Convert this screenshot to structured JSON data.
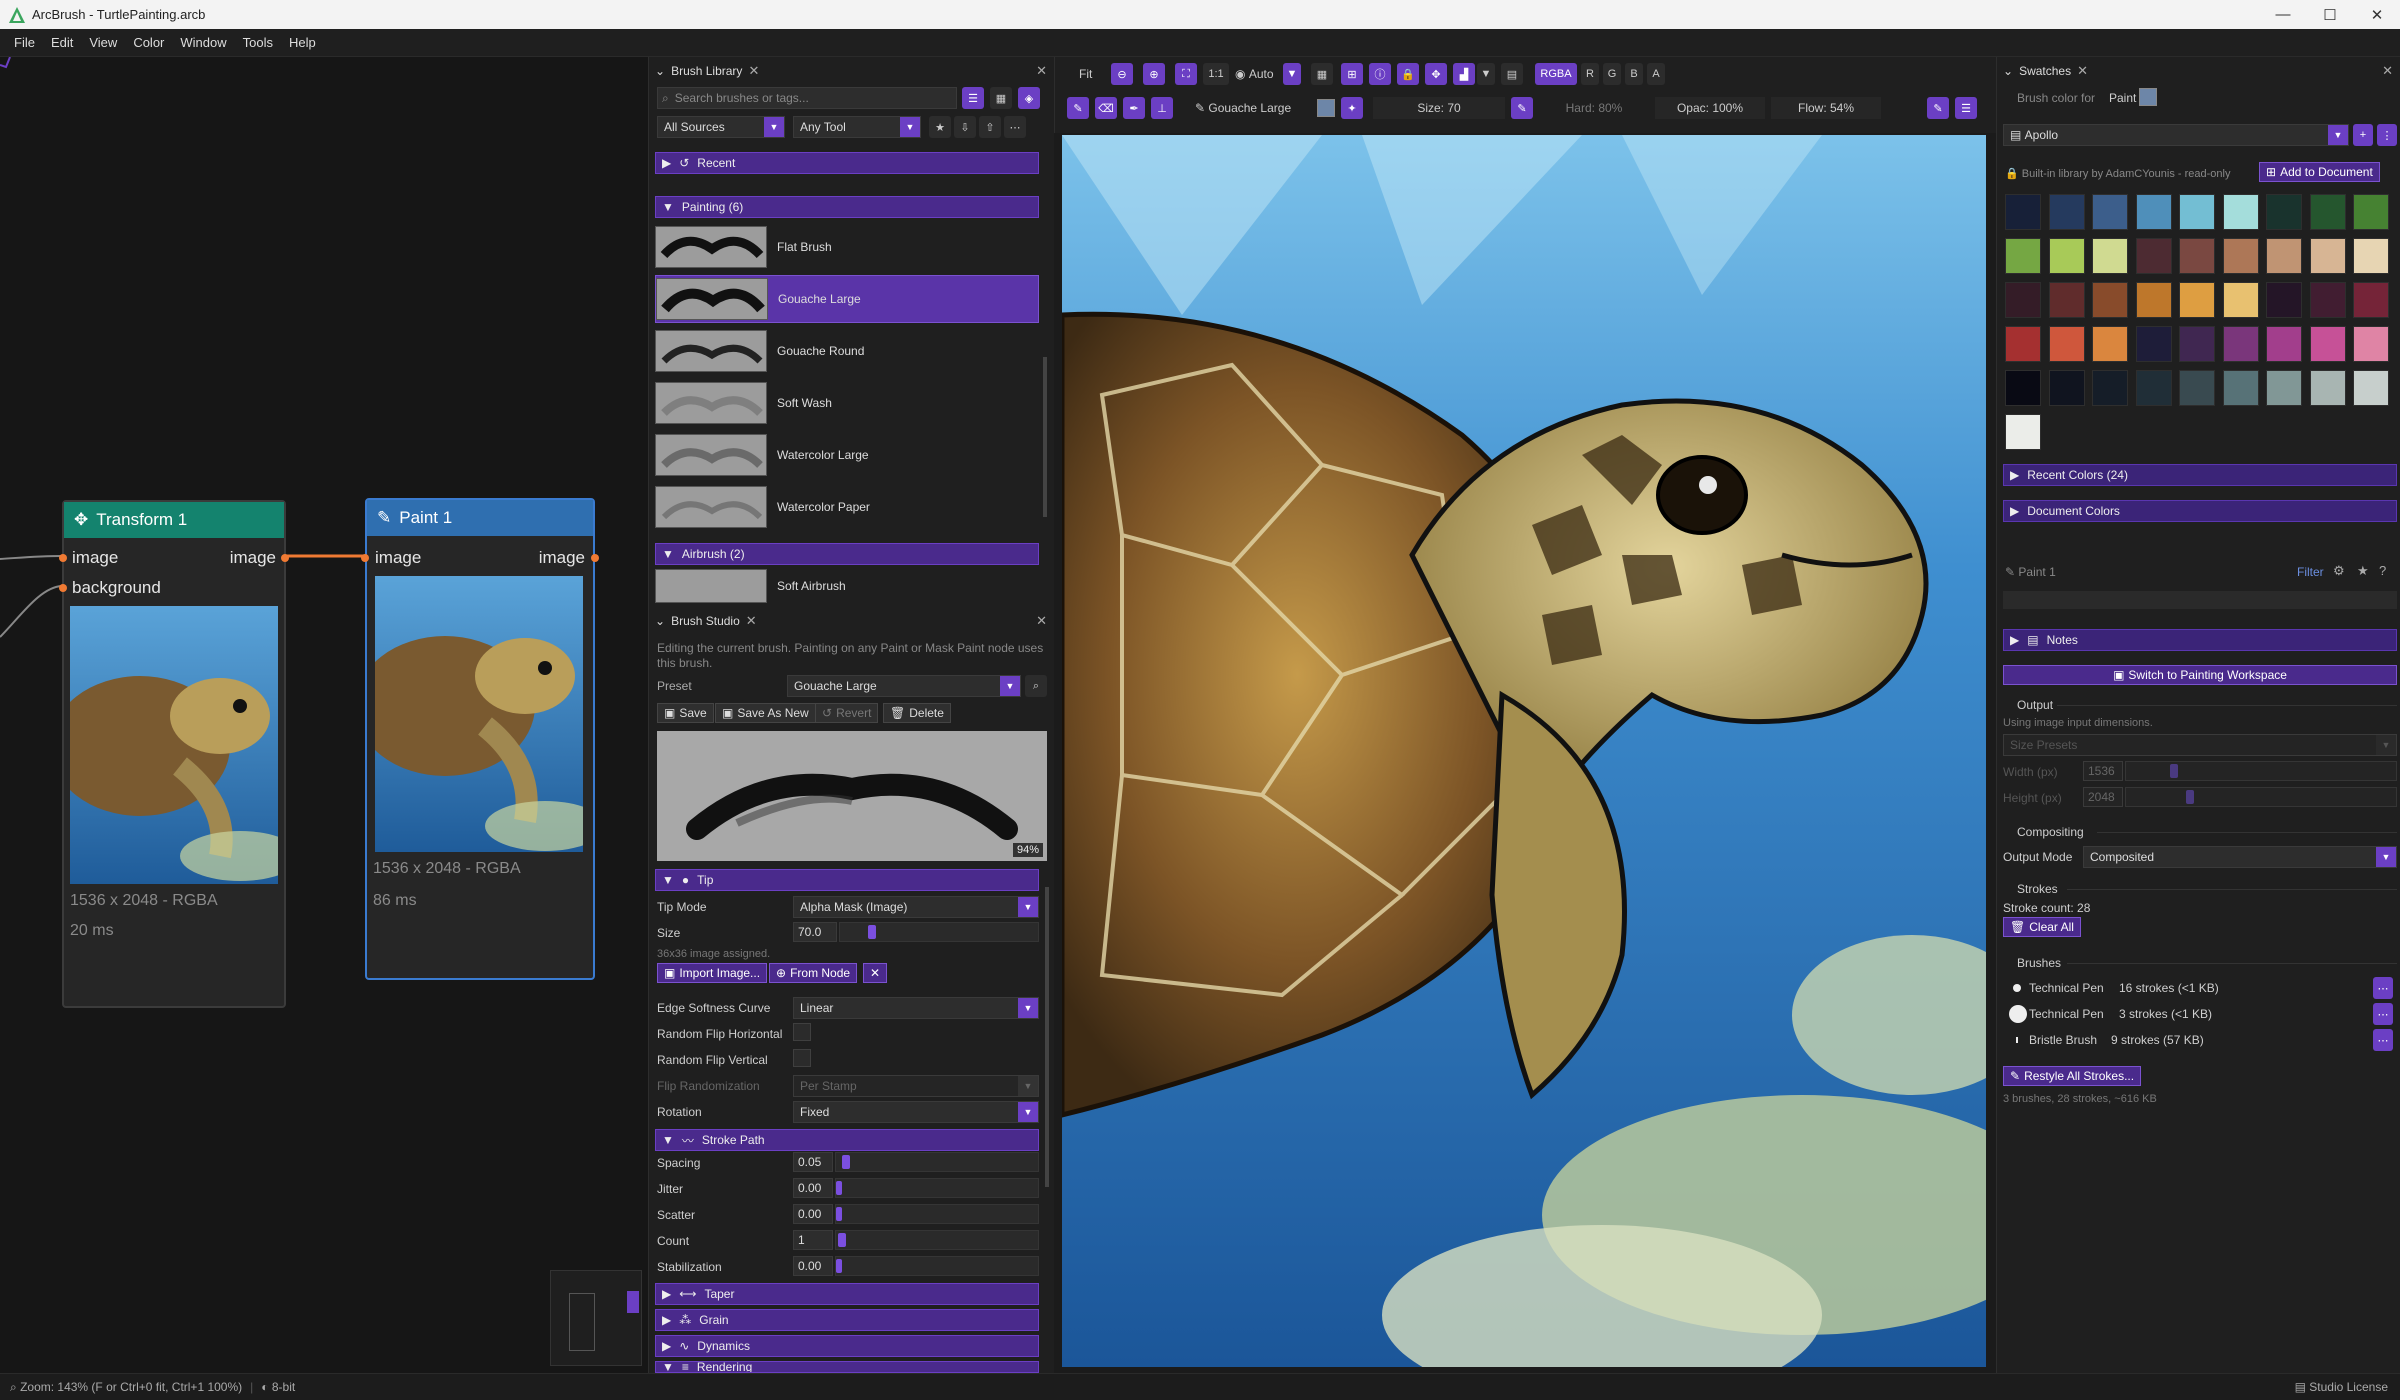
{
  "window": {
    "title": "ArcBrush - TurtlePainting.arcb",
    "minimize": "—",
    "maximize": "☐",
    "close": "✕"
  },
  "menu": [
    "File",
    "Edit",
    "View",
    "Color",
    "Window",
    "Tools",
    "Help"
  ],
  "nodes": {
    "transform": {
      "title": "Transform 1",
      "in_image": "image",
      "in_background": "background",
      "out_image": "image",
      "dims": "1536 x 2048  -  RGBA",
      "time": "20 ms",
      "header_color": "#14836e"
    },
    "paint": {
      "title": "Paint 1",
      "in_image": "image",
      "out_image": "image",
      "dims": "1536 x 2048  -  RGBA",
      "time": "86 ms",
      "header_color": "#2f6fb0"
    }
  },
  "brush_library": {
    "title": "Brush Library",
    "search_placeholder": "Search brushes or tags...",
    "source_filter": "All Sources",
    "tool_filter": "Any Tool",
    "recent": "Recent",
    "painting_group": "Painting (6)",
    "brushes": [
      "Flat Brush",
      "Gouache Large",
      "Gouache Round",
      "Soft Wash",
      "Watercolor Large",
      "Watercolor Paper"
    ],
    "selected": "Gouache Large",
    "airbrush_group": "Airbrush (2)",
    "airbrushes": [
      "Soft Airbrush"
    ]
  },
  "brush_studio": {
    "title": "Brush Studio",
    "desc": "Editing the current brush. Painting on any Paint or Mask Paint node uses this brush.",
    "preset_label": "Preset",
    "preset": "Gouache Large",
    "save": "Save",
    "save_as_new": "Save As New",
    "revert": "Revert",
    "delete": "Delete",
    "preview_zoom": "94%",
    "tip_section": "Tip",
    "tip_mode_label": "Tip Mode",
    "tip_mode": "Alpha Mask (Image)",
    "size_label": "Size",
    "size": "70.0",
    "size_level": 0.14,
    "image_note": "36x36 image assigned.",
    "import_image": "Import Image...",
    "from_node": "From Node",
    "clear": "✕",
    "edge_label": "Edge Softness Curve",
    "edge": "Linear",
    "flip_h": "Random Flip Horizontal",
    "flip_v": "Random Flip Vertical",
    "flip_rand_label": "Flip Randomization",
    "flip_rand": "Per Stamp",
    "rotation_label": "Rotation",
    "rotation": "Fixed",
    "stroke_path": "Stroke Path",
    "params": [
      {
        "label": "Spacing",
        "value": "0.05",
        "level": 0.03
      },
      {
        "label": "Jitter",
        "value": "0.00",
        "level": 0.0
      },
      {
        "label": "Scatter",
        "value": "0.00",
        "level": 0.0
      },
      {
        "label": "Count",
        "value": "1",
        "level": 0.01
      },
      {
        "label": "Stabilization",
        "value": "0.00",
        "level": 0.0
      }
    ],
    "collapsed": [
      "Taper",
      "Grain",
      "Dynamics",
      "Rendering"
    ]
  },
  "toolbar": {
    "fit": "Fit",
    "zoom_auto": "Auto",
    "one_to_one": "1:1",
    "channels": [
      "RGBA",
      "R",
      "G",
      "B",
      "A"
    ],
    "brush_name": "Gouache Large",
    "size": "Size: 70",
    "hard": "Hard: 80%",
    "opac": "Opac: 100%",
    "flow": "Flow: 54%"
  },
  "swatches": {
    "title": "Swatches",
    "brush_color_for": "Brush color for",
    "node": "Paint 1",
    "current_color": "#6d86a8",
    "palette": "Apollo",
    "readonly_note": "Built-in library by AdamCYounis - read-only",
    "add_to_document": "Add to Document",
    "colors": [
      "#172038",
      "#253a5e",
      "#3c5e8b",
      "#4f8fba",
      "#73bed3",
      "#a4dddb",
      "#19332d",
      "#25562e",
      "#468232",
      "#75a743",
      "#a8ca58",
      "#d0da91",
      "#4d2b32",
      "#7a4841",
      "#ad7757",
      "#c09473",
      "#d7b594",
      "#e7d5b3",
      "#341c27",
      "#602c2c",
      "#884b2b",
      "#be772b",
      "#de9e41",
      "#e8c170",
      "#241527",
      "#411d31",
      "#752438",
      "#a53030",
      "#cf573c",
      "#da863e",
      "#1e1d39",
      "#402751",
      "#7a367b",
      "#a23e8c",
      "#c65197",
      "#df84a5",
      "#090a14",
      "#10141f",
      "#151d28",
      "#202e37",
      "#394a50",
      "#577277",
      "#819796",
      "#a8b5b2",
      "#c7cfcc",
      "#ebede9"
    ],
    "recent_colors": "Recent Colors (24)",
    "document_colors": "Document Colors"
  },
  "properties": {
    "node": "Paint 1",
    "filter": "Filter",
    "notes": "Notes",
    "switch_workspace": "Switch to Painting Workspace",
    "output": "Output",
    "output_note": "Using image input dimensions.",
    "size_presets": "Size Presets",
    "width_label": "Width (px)",
    "width": "1536",
    "height_label": "Height (px)",
    "height": "2048",
    "compositing": "Compositing",
    "output_mode_label": "Output Mode",
    "output_mode": "Composited",
    "strokes": "Strokes",
    "stroke_count": "Stroke count: 28",
    "clear_all": "Clear All",
    "brushes_label": "Brushes",
    "brushes": [
      {
        "name": "Technical Pen",
        "info": "16 strokes  (<1 KB)"
      },
      {
        "name": "Technical Pen",
        "info": "3 strokes  (<1 KB)"
      },
      {
        "name": "Bristle Brush",
        "info": "9 strokes  (57 KB)"
      }
    ],
    "restyle": "Restyle All Strokes...",
    "summary": "3 brushes, 28 strokes, ~616 KB"
  },
  "status": {
    "zoom": "Zoom: 143%  (F or Ctrl+0 fit, Ctrl+1 100%)",
    "depth": "8-bit",
    "license": "Studio License"
  }
}
